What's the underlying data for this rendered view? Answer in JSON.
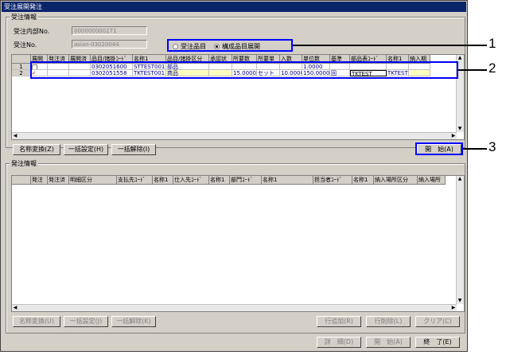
{
  "window": {
    "title": "受注展開発注"
  },
  "order_group": {
    "label": "受注情報",
    "internal_no_label": "受注内部No.",
    "internal_no_value": "000000000271",
    "order_no_label": "受注No.",
    "order_no_value": "asian-03020044"
  },
  "radios": [
    {
      "label": "受注品目",
      "selected": false
    },
    {
      "label": "構成品目展開",
      "selected": true
    }
  ],
  "top_grid": {
    "headers": [
      "",
      "展開",
      "発注済",
      "展開済",
      "品目/諸掛ｺｰﾄﾞ",
      "名称1",
      "品目/諸掛区分",
      "承認状",
      "所要数",
      "所要単",
      "入数",
      "単位数",
      "基準",
      "部品表ｺｰﾄﾞ",
      "名称1",
      "納入期"
    ],
    "rows": [
      [
        "1",
        "",
        "",
        "",
        "0302051600",
        "STTEST001",
        "部品",
        "",
        "",
        "",
        "",
        "1.0000",
        "",
        "",
        "",
        ""
      ],
      [
        "2",
        "✓",
        "",
        "",
        "0302051558",
        "TKTEST001",
        "商品",
        "",
        "15.0000",
        "セット",
        "10.0000",
        "150.0000",
        "回",
        "TKTEST",
        "TKTEST",
        ""
      ]
    ]
  },
  "top_buttons": {
    "rename": "名称変換(Z)",
    "bulk_set": "一括設定(H)",
    "bulk_clear": "一括解除(I)",
    "start": "開　始(A)"
  },
  "order_info_group": {
    "label": "発注情報",
    "headers": [
      "",
      "発注",
      "発注済",
      "明細区分",
      "支払先ｺｰﾄﾞ",
      "名称1",
      "仕入先ｺｰﾄﾞ",
      "名称1",
      "部門ｺｰﾄﾞ",
      "名称1",
      "担当者ｺｰﾄﾞ",
      "名称1",
      "納入場所区分",
      "納入場所"
    ]
  },
  "bottom_buttons": {
    "rename": "名称変換(U)",
    "bulk_set": "一括設定(J)",
    "bulk_clear": "一括解除(K)",
    "add_row": "行追加(R)",
    "delete_row": "行削除(L)",
    "clear": "クリア(C)"
  },
  "footer_buttons": {
    "detail": "詳　細(D)",
    "start": "開　始(A)",
    "end": "終　了(E)"
  },
  "callouts": [
    "1",
    "2",
    "3"
  ],
  "colors": {
    "titlebar": "#0a246a",
    "highlight": "#0000ff",
    "window_bg": "#d4d0c8"
  }
}
